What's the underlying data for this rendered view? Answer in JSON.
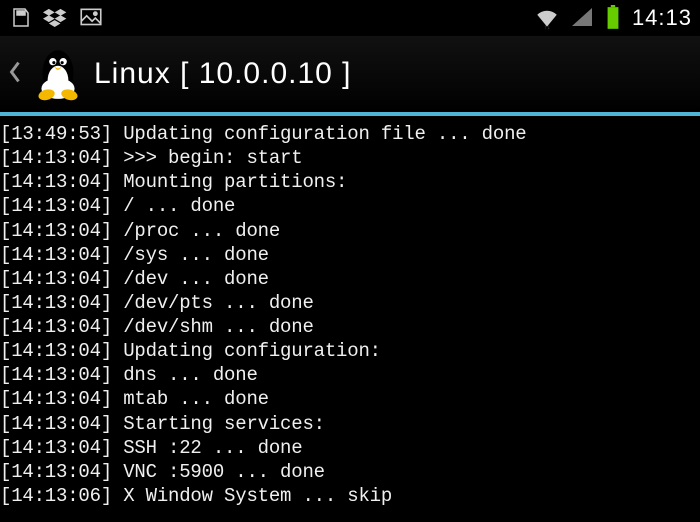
{
  "status_bar": {
    "clock": "14:13"
  },
  "header": {
    "title": "Linux",
    "ip": "[ 10.0.0.10 ]"
  },
  "terminal": {
    "lines": [
      {
        "ts": "[13:49:53]",
        "msg": "Updating configuration file ... done"
      },
      {
        "ts": "[14:13:04]",
        "msg": ">>> begin: start"
      },
      {
        "ts": "[14:13:04]",
        "msg": "Mounting partitions:"
      },
      {
        "ts": "[14:13:04]",
        "msg": "/ ... done"
      },
      {
        "ts": "[14:13:04]",
        "msg": "/proc ... done"
      },
      {
        "ts": "[14:13:04]",
        "msg": "/sys ... done"
      },
      {
        "ts": "[14:13:04]",
        "msg": "/dev ... done"
      },
      {
        "ts": "[14:13:04]",
        "msg": "/dev/pts ... done"
      },
      {
        "ts": "[14:13:04]",
        "msg": "/dev/shm ... done"
      },
      {
        "ts": "[14:13:04]",
        "msg": "Updating configuration:"
      },
      {
        "ts": "[14:13:04]",
        "msg": "dns ... done"
      },
      {
        "ts": "[14:13:04]",
        "msg": "mtab ... done"
      },
      {
        "ts": "[14:13:04]",
        "msg": "Starting services:"
      },
      {
        "ts": "[14:13:04]",
        "msg": "SSH :22 ... done"
      },
      {
        "ts": "[14:13:04]",
        "msg": "VNC :5900 ... done"
      },
      {
        "ts": "[14:13:06]",
        "msg": "X Window System ... skip"
      }
    ]
  }
}
